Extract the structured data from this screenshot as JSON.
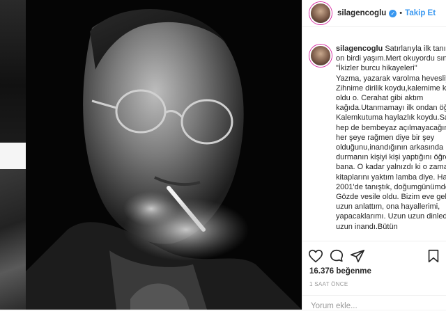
{
  "header": {
    "username": "silagencoglu",
    "verified_icon": "verified-badge-icon",
    "separator": "•",
    "follow_label": "Takip Et"
  },
  "caption": {
    "username": "silagencoglu",
    "text": "Satırlarıyla ilk tanıştığımda on birdi yaşım.Mert okuyordu sınıfta. \"İkizler burcu hikayeleri\"\nYazma, yazarak varolma hevesliydim. Zihnime dirilik koydu,kalemime korku oldu o. Cerahat gibi aktım kağıda.Utanmamayı ilk ondan öğrendim. Kalemkutuma haylazlık koydu.Sayfaların hep de bembeyaz açılmayacağını ama her şeye rağmen diye bir şey olduğunu,inandığının arkasında durmanın kişiyi kişi yaptığını öğretti bana. O kadar yalnızdı ki o zaman onun kitaplarını yaktım lamba diye. Haziran 2001'de tanıştık, doğumgünümde. Gözde vesile oldu. Bizim eve geldi.Uzun uzun anlattım, ona hayallerimi, yapacaklarımı. Uzun uzun dinledi.Uzun uzun inandı.Bütün"
  },
  "actions": {
    "like_icon": "heart-icon",
    "comment_icon": "comment-icon",
    "share_icon": "share-icon",
    "save_icon": "bookmark-icon"
  },
  "likes": "16.376 beğenme",
  "timestamp": "1 SAAT ÖNCE",
  "comment": {
    "placeholder": "Yorum ekle..."
  },
  "colors": {
    "accent": "#3897f0",
    "text": "#262626",
    "muted": "#999999",
    "border": "#efefef"
  }
}
